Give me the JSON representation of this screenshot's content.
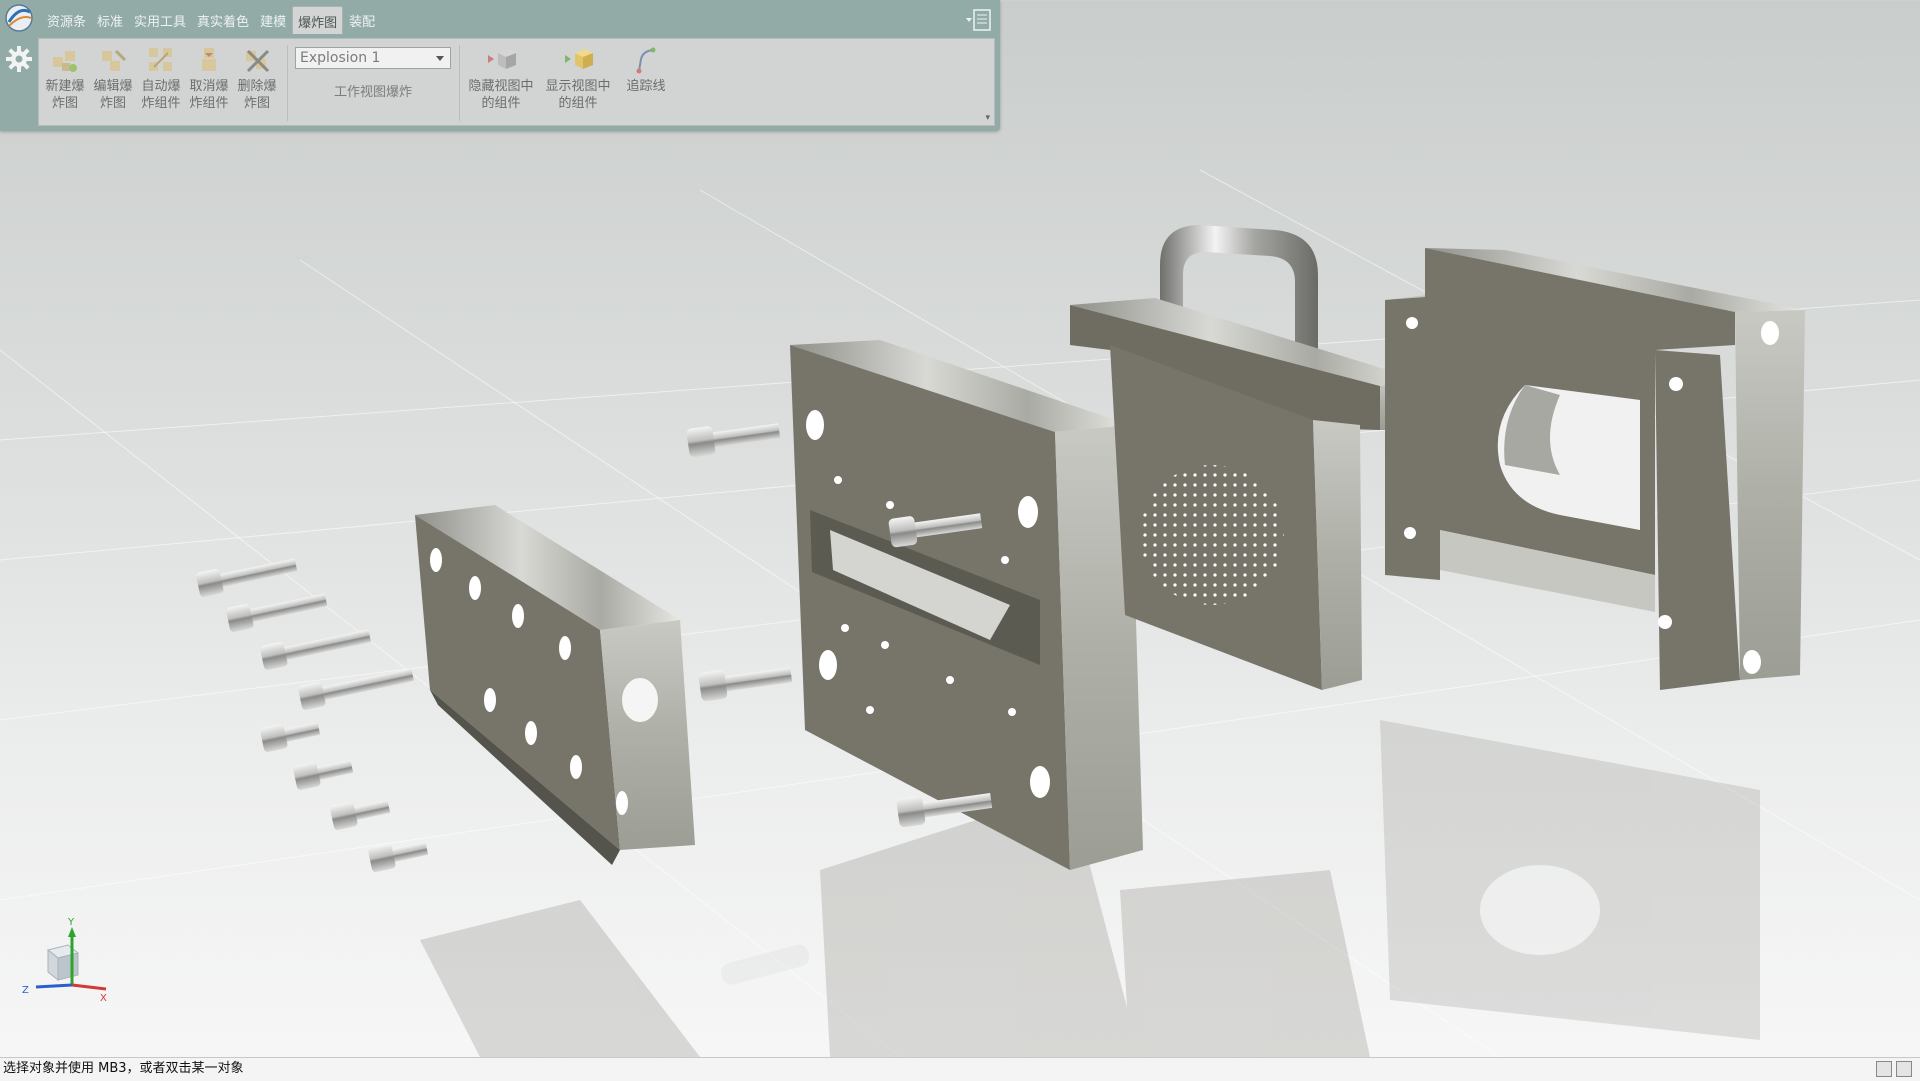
{
  "ribbon": {
    "tabs": [
      {
        "label": "资源条",
        "active": false
      },
      {
        "label": "标准",
        "active": false
      },
      {
        "label": "实用工具",
        "active": false
      },
      {
        "label": "真实着色",
        "active": false
      },
      {
        "label": "建模",
        "active": false
      },
      {
        "label": "爆炸图",
        "active": true
      },
      {
        "label": "装配",
        "active": false
      }
    ],
    "tools_left": [
      {
        "line1": "新建爆",
        "line2": "炸图",
        "icon": "new-explosion-icon"
      },
      {
        "line1": "编辑爆",
        "line2": "炸图",
        "icon": "edit-explosion-icon"
      },
      {
        "line1": "自动爆",
        "line2": "炸组件",
        "icon": "auto-explode-icon"
      },
      {
        "line1": "取消爆",
        "line2": "炸组件",
        "icon": "unexplode-icon"
      },
      {
        "line1": "删除爆",
        "line2": "炸图",
        "icon": "delete-explosion-icon"
      }
    ],
    "explosion_select": {
      "value": "Explosion 1"
    },
    "group_label": "工作视图爆炸",
    "tools_right": [
      {
        "line1": "隐藏视图中",
        "line2": "的组件",
        "icon": "hide-component-icon"
      },
      {
        "line1": "显示视图中",
        "line2": "的组件",
        "icon": "show-component-icon"
      },
      {
        "line1": "追踪线",
        "line2": "",
        "icon": "tracking-line-icon"
      }
    ]
  },
  "triad": {
    "x_label": "X",
    "y_label": "Y",
    "z_label": "Z"
  },
  "status": {
    "message": "选择对象并使用 MB3，或者双击某一对象"
  },
  "colors": {
    "ribbon_bg": "#92aba7",
    "panel_bg": "#d2d4d3",
    "part_face": "#77756a",
    "part_top": "#c2c3bc",
    "part_side": "#a7a89e"
  }
}
